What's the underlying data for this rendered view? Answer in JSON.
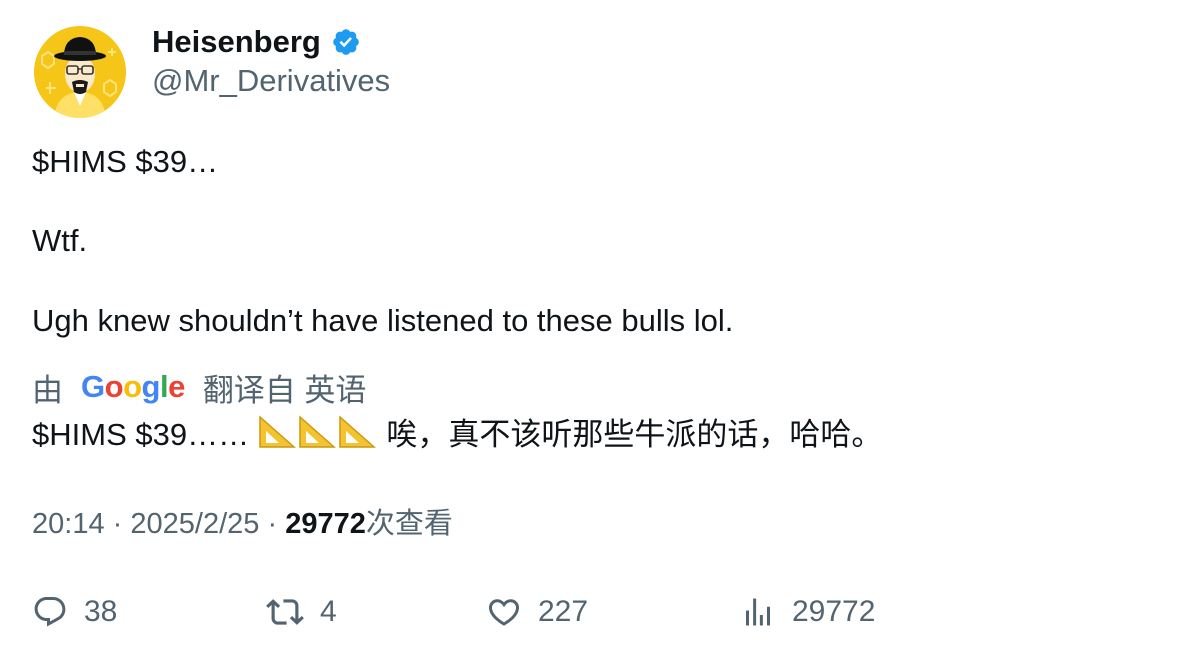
{
  "author": {
    "display_name": "Heisenberg",
    "handle": "@Mr_Derivatives",
    "verified_icon": "verified-badge-icon",
    "avatar_icon": "heisenberg-avatar"
  },
  "tweet": {
    "line1": "$HIMS $39…",
    "line2": "Wtf.",
    "line3": "Ugh knew shouldn’t have listened to these bulls lol."
  },
  "translation": {
    "prefix": "由",
    "provider": "Google",
    "suffix": "翻译自 英语",
    "text_before": "$HIMS $39……",
    "emoji": "📐📐📐",
    "text_after": "唉，真不该听那些牛派的话，哈哈。"
  },
  "meta": {
    "time": "20:14",
    "sep1": "·",
    "date": "2025/2/25",
    "sep2": "·",
    "views_count": "29772",
    "views_label": "次查看"
  },
  "actions": {
    "replies": "38",
    "retweets": "4",
    "likes": "227",
    "views": "29772"
  },
  "colors": {
    "text": "#0f1419",
    "secondary": "#536471",
    "verified": "#1d9bf0",
    "avatar_bg": "#f5c518"
  }
}
